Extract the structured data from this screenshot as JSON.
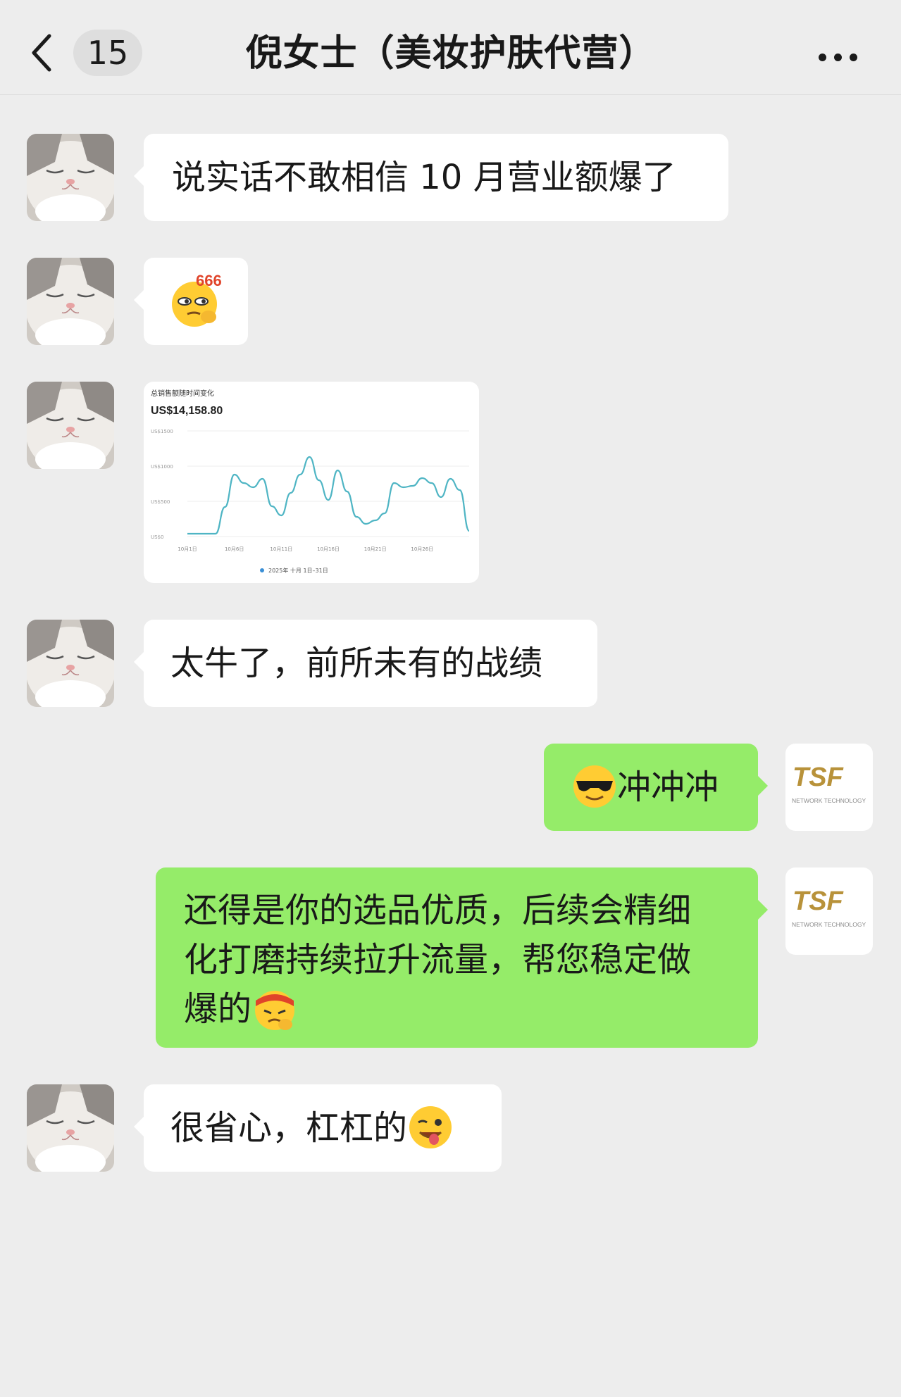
{
  "header": {
    "unread_count": "15",
    "title": "倪女士（美妆护肤代营）"
  },
  "messages": [
    {
      "side": "in",
      "text": "说实话不敢相信 10 月营业额爆了"
    },
    {
      "side": "in",
      "emoji": "thinking-666-emoji",
      "emoji_text": "666"
    },
    {
      "side": "in",
      "type": "image-chart"
    },
    {
      "side": "in",
      "text": "太牛了，前所未有的战绩"
    },
    {
      "side": "out",
      "emoji": "sunglasses-emoji",
      "text": "冲冲冲"
    },
    {
      "side": "out",
      "lines": [
        "还得是你的选品优质，后续会精细",
        "化打磨持续拉升流量，帮您稳定做",
        "爆的"
      ],
      "emoji": "headband-emoji"
    },
    {
      "side": "in",
      "text": "很省心，杠杠的",
      "emoji": "winking-tongue-emoji"
    }
  ],
  "tsf_avatar": {
    "logo_text": "TSF",
    "subtitle": "NETWORK TECHNOLOGY"
  },
  "chart_data": {
    "type": "line",
    "title": "总销售额随时间变化",
    "total": "US$14,158.80",
    "x_tick_labels": [
      "10月1日",
      "10月6日",
      "10月11日",
      "10月16日",
      "10月21日",
      "10月26日"
    ],
    "y_tick_labels": [
      "US$1500",
      "US$1000",
      "US$500",
      "US$0"
    ],
    "ylim": [
      0,
      1500
    ],
    "series": [
      {
        "name": "2025年 十月 1日–31日",
        "color": "#4fb5c4",
        "x": [
          1,
          2,
          3,
          4,
          5,
          6,
          7,
          8,
          9,
          10,
          11,
          12,
          13,
          14,
          15,
          16,
          17,
          18,
          19,
          20,
          21,
          22,
          23,
          24,
          25,
          26,
          27,
          28,
          29,
          30,
          31
        ],
        "values": [
          40,
          40,
          40,
          40,
          420,
          880,
          760,
          700,
          820,
          430,
          300,
          620,
          880,
          1130,
          800,
          520,
          940,
          640,
          280,
          180,
          230,
          330,
          760,
          700,
          720,
          830,
          760,
          560,
          820,
          660,
          80
        ]
      }
    ],
    "legend": "bottom",
    "grid": true
  }
}
